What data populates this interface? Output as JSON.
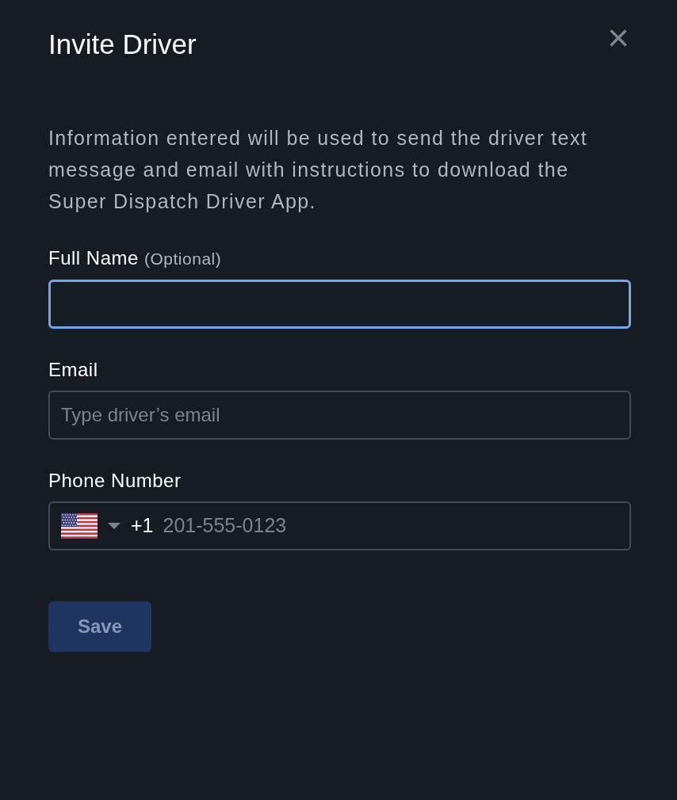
{
  "dialog": {
    "title": "Invite Driver",
    "close": "×",
    "description": "Information entered will be used to send the driver text message and email with instructions to download the Super Dispatch Driver App."
  },
  "fields": [
    {
      "kind": "text",
      "label": "Full Name",
      "hint": "(Optional)",
      "focused": true
    },
    {
      "kind": "text",
      "label": "Email",
      "placeholder": "Type driver’s email",
      "focused": false
    },
    {
      "kind": "phone",
      "label": "Phone Number",
      "country_code": "+1",
      "placeholder": "201-555-0123",
      "focused": false
    }
  ],
  "save_button": {
    "label": "Save",
    "disabled": true
  }
}
